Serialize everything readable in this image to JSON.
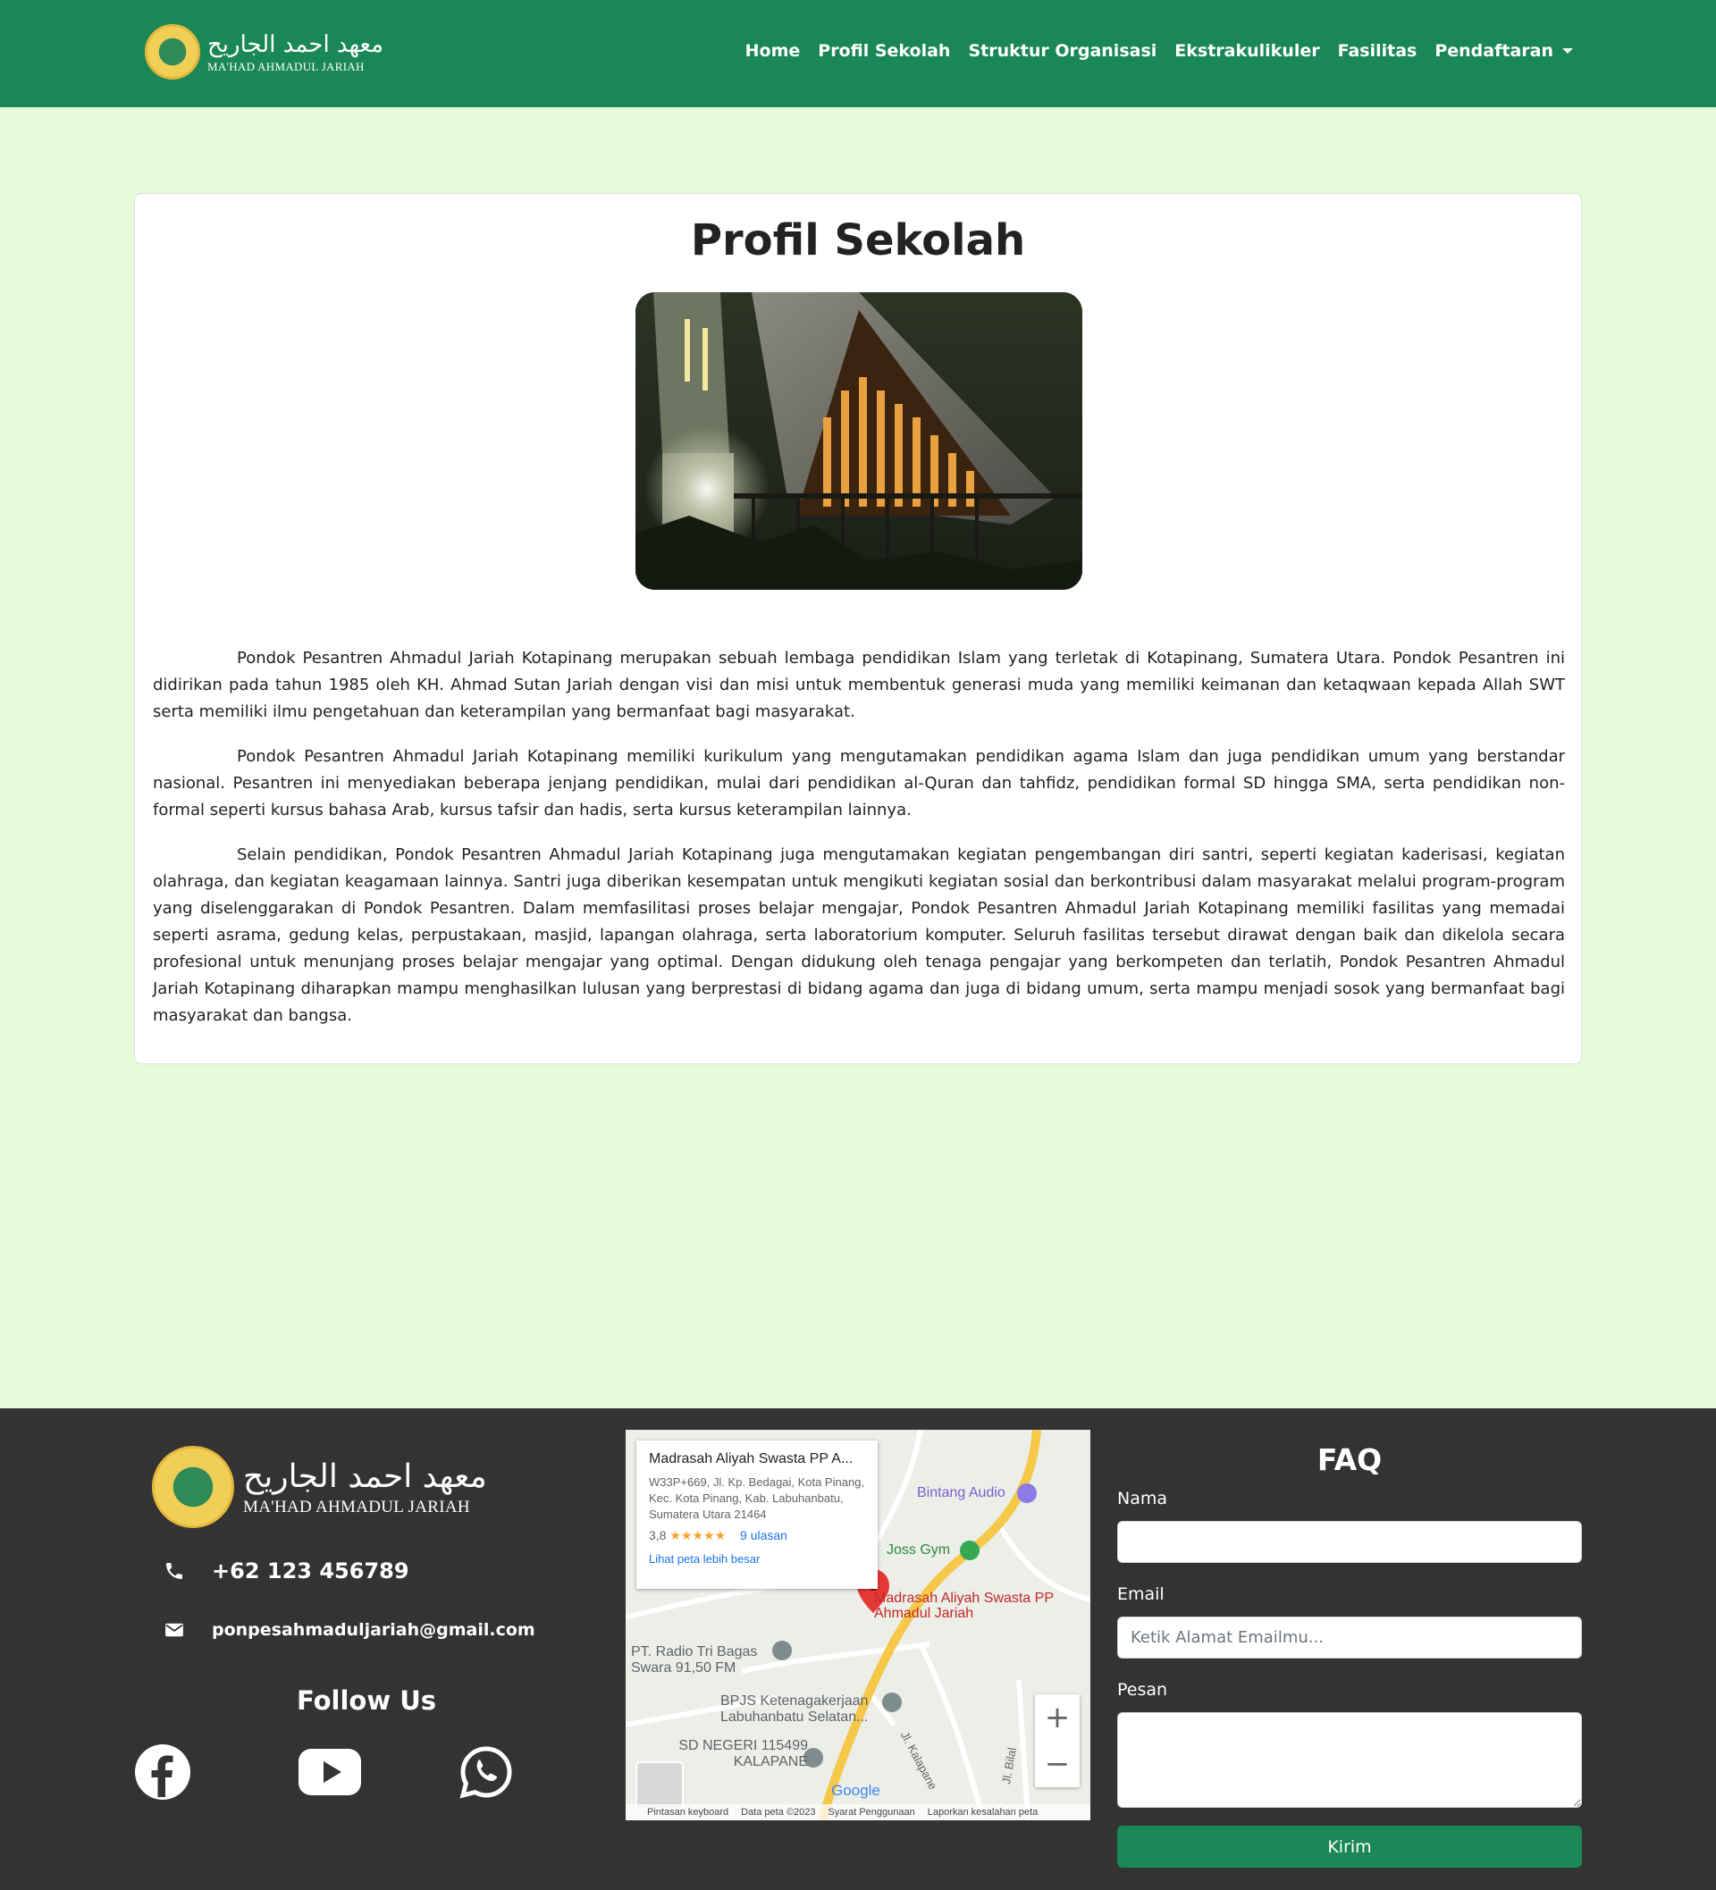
{
  "navbar": {
    "brand_arabic": "معهد احمد الجاريح",
    "brand_latin": "MA'HAD AHMADUL JARIAH",
    "links": [
      "Home",
      "Profil Sekolah",
      "Struktur Organisasi",
      "Ekstrakulikuler",
      "Fasilitas",
      "Pendaftaran"
    ]
  },
  "main": {
    "title": "Profil Sekolah",
    "paragraphs": [
      "Pondok Pesantren Ahmadul Jariah Kotapinang merupakan sebuah lembaga pendidikan Islam yang terletak di Kotapinang, Sumatera Utara. Pondok Pesantren ini didirikan pada tahun 1985 oleh KH. Ahmad Sutan Jariah dengan visi dan misi untuk membentuk generasi muda yang memiliki keimanan dan ketaqwaan kepada Allah SWT serta memiliki ilmu pengetahuan dan keterampilan yang bermanfaat bagi masyarakat.",
      "Pondok Pesantren Ahmadul Jariah Kotapinang memiliki kurikulum yang mengutamakan pendidikan agama Islam dan juga pendidikan umum yang berstandar nasional. Pesantren ini menyediakan beberapa jenjang pendidikan, mulai dari pendidikan al-Quran dan tahfidz, pendidikan formal SD hingga SMA, serta pendidikan non-formal seperti kursus bahasa Arab, kursus tafsir dan hadis, serta kursus keterampilan lainnya.",
      "Selain pendidikan, Pondok Pesantren Ahmadul Jariah Kotapinang juga mengutamakan kegiatan pengembangan diri santri, seperti kegiatan kaderisasi, kegiatan olahraga, dan kegiatan keagamaan lainnya. Santri juga diberikan kesempatan untuk mengikuti kegiatan sosial dan berkontribusi dalam masyarakat melalui program-program yang diselenggarakan di Pondok Pesantren. Dalam memfasilitasi proses belajar mengajar, Pondok Pesantren Ahmadul Jariah Kotapinang memiliki fasilitas yang memadai seperti asrama, gedung kelas, perpustakaan, masjid, lapangan olahraga, serta laboratorium komputer. Seluruh fasilitas tersebut dirawat dengan baik dan dikelola secara profesional untuk menunjang proses belajar mengajar yang optimal. Dengan didukung oleh tenaga pengajar yang berkompeten dan terlatih, Pondok Pesantren Ahmadul Jariah Kotapinang diharapkan mampu menghasilkan lulusan yang berprestasi di bidang agama dan juga di bidang umum, serta mampu menjadi sosok yang bermanfaat bagi masyarakat dan bangsa."
    ]
  },
  "footer": {
    "brand_arabic": "معهد احمد الجاريح",
    "brand_latin": "MA'HAD AHMADUL JARIAH",
    "phone": "+62 123 456789",
    "email": "ponpesahmaduljariah@gmail.com",
    "follow_title": "Follow Us",
    "social_icons": [
      "facebook-icon",
      "youtube-icon",
      "whatsapp-icon"
    ],
    "map": {
      "place_title": "Madrasah Aliyah Swasta PP A...",
      "address": "W33P+669, Jl. Kp. Bedagai, Kota Pinang, Kec. Kota Pinang, Kab. Labuhanbatu, Sumatera Utara 21464",
      "rating": "3,8",
      "stars": "★★★★★",
      "reviews": "9 ulasan",
      "view_larger": "Lihat peta lebih besar",
      "places": [
        "Bintang Audio",
        "Joss Gym",
        "Madrasah Aliyah Swasta PP Ahmadul Jariah",
        "PT. Radio Tri Bagas Swara 91,50 FM",
        "BPJS Ketenagakerjaan Labuhanbatu Selatan...",
        "SD NEGERI 115499 KALAPANE",
        "Jl. Kalapane",
        "Jl. Bilal"
      ],
      "google": "Google",
      "zoom_in": "+",
      "zoom_out": "−",
      "footer_links": [
        "Pintasan keyboard",
        "Data peta ©2023",
        "Syarat Penggunaan",
        "Laporkan kesalahan peta"
      ]
    },
    "faq": {
      "title": "FAQ",
      "name_label": "Nama",
      "name_value": "",
      "email_label": "Email",
      "email_placeholder": "Ketik Alamat Emailmu...",
      "message_label": "Pesan",
      "message_value": "",
      "submit_label": "Kirim"
    }
  },
  "colors": {
    "primary_green": "#1a8757",
    "page_bg": "#e5fad7",
    "footer_bg": "#333333"
  }
}
